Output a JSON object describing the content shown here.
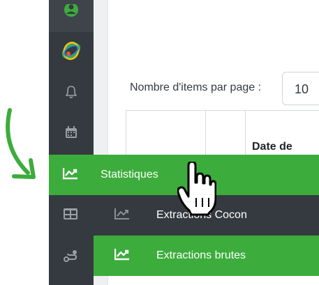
{
  "toolbar": {
    "items_per_page_label": "Nombre d'items par page :",
    "items_per_page_value": "10"
  },
  "table": {
    "header_date": "Date de"
  },
  "menu": {
    "statistiques": "Statistiques",
    "extractions_cocon": "Extractions Cocon",
    "extractions_brutes": "Extractions brutes"
  },
  "sidebar_icons": [
    "user-avatar-icon",
    "brand-logo-icon",
    "bell-icon",
    "calendar-icon",
    "chart-line-icon",
    "table-icon",
    "route-icon"
  ],
  "colors": {
    "accent_green": "#3cac3c",
    "sidebar_dark": "#353a40"
  }
}
